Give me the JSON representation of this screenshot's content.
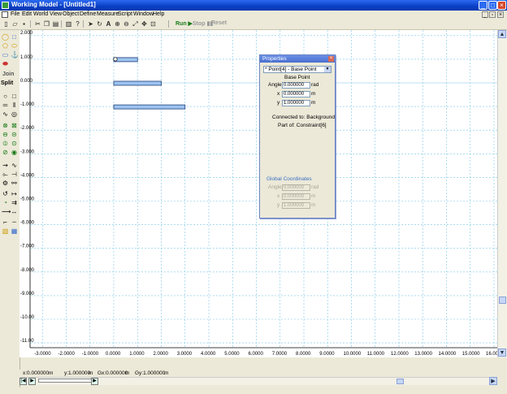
{
  "window": {
    "title": "Working Model - [Untitled1]"
  },
  "menu": [
    "File",
    "Edit",
    "World",
    "View",
    "Object",
    "Define",
    "Measure",
    "Script",
    "Window",
    "Help"
  ],
  "toolbar": {
    "run_label": "Run",
    "stop_label": "Stop",
    "reset_label": "Reset"
  },
  "palette": {
    "join_label": "Join",
    "split_label": "Split"
  },
  "y_axis_labels": [
    "1.000",
    "0.000",
    "-1.000",
    "-2.000",
    "-3.000",
    "-4.000",
    "-5.000",
    "-6.000",
    "-7.000",
    "-8.000",
    "-9.000",
    "-10.00",
    "-11.00"
  ],
  "y_axis_top": "2.000",
  "x_axis_labels": [
    "-3.0000",
    "-2.0000",
    "-1.0000",
    "0.0000",
    "1.0000",
    "2.0000",
    "3.0000",
    "4.0000",
    "5.0000",
    "6.0000",
    "7.0000",
    "8.0000",
    "9.0000",
    "10.0000",
    "11.0000",
    "12.0000",
    "13.0000",
    "14.0000",
    "15.0000",
    "16.000"
  ],
  "status": {
    "x": "x:0.000000",
    "x_unit": "m",
    "y": "y:1.000000",
    "y_unit": "m",
    "gx": "Gx:0.000000",
    "gx_unit": "m",
    "gy": "Gy:1.000000",
    "gy_unit": "m"
  },
  "properties": {
    "title": "Properties",
    "selected_object": "* Point[4] - Base Point",
    "section_label": "Base Point",
    "angle_label": "Angle",
    "angle_value": "0.000000",
    "angle_unit": "rad",
    "x_label": "x",
    "x_value": "0.000000",
    "x_unit": "m",
    "y_label": "y",
    "y_value": "1.000000",
    "y_unit": "m",
    "connected_to": "Connected to: Background",
    "part_of": "Part of: Constraint[6]",
    "global_title": "Global Coordinates",
    "g_angle_label": "Angle",
    "g_angle_value": "0.000000",
    "g_angle_unit": "rad",
    "g_x_label": "x",
    "g_x_value": "0.000000",
    "g_x_unit": "m",
    "g_y_label": "y",
    "g_y_value": "1.000000",
    "g_y_unit": "m"
  },
  "colors": {
    "grid": "#7cc6e8",
    "body_fill": "#9dc3ef",
    "body_stroke": "#1f3d7a"
  }
}
